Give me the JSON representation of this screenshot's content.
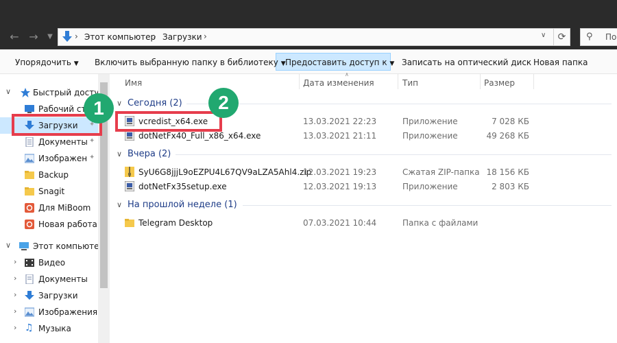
{
  "address": {
    "crumbs": [
      "Этот компьютер",
      "Загрузки"
    ],
    "search_placeholder": "По"
  },
  "commands": {
    "organize": "Упорядочить",
    "include_library": "Включить выбранную папку в библиотеку",
    "share": "Предоставить доступ к",
    "burn": "Записать на оптический диск",
    "new_folder": "Новая папка"
  },
  "sidebar": {
    "quick_access": "Быстрый доступ",
    "quick_items": [
      {
        "label": "Рабочий стол",
        "icon": "desktop-icon",
        "pinned": true
      },
      {
        "label": "Загрузки",
        "icon": "downloads-icon",
        "pinned": true,
        "selected": true
      },
      {
        "label": "Документы",
        "icon": "documents-icon",
        "pinned": true
      },
      {
        "label": "Изображения",
        "icon": "pictures-icon",
        "pinned": true
      },
      {
        "label": "Backup",
        "icon": "folder-icon",
        "pinned": false
      },
      {
        "label": "Snagit",
        "icon": "folder-icon",
        "pinned": false
      },
      {
        "label": "Для MiBoom",
        "icon": "app-folder-icon",
        "pinned": false
      },
      {
        "label": "Новая работа",
        "icon": "app-folder-icon",
        "pinned": false
      }
    ],
    "this_pc": "Этот компьютер",
    "pc_items": [
      {
        "label": "Видео",
        "icon": "video-icon"
      },
      {
        "label": "Документы",
        "icon": "documents-icon"
      },
      {
        "label": "Загрузки",
        "icon": "downloads-icon"
      },
      {
        "label": "Изображения",
        "icon": "pictures-icon"
      },
      {
        "label": "Музыка",
        "icon": "music-icon"
      }
    ]
  },
  "columns": {
    "name": "Имя",
    "date": "Дата изменения",
    "type": "Тип",
    "size": "Размер"
  },
  "groups": [
    {
      "title": "Сегодня (2)",
      "files": [
        {
          "name": "vcredist_x64.exe",
          "date": "13.03.2021 22:23",
          "type": "Приложение",
          "size": "7 028 КБ",
          "icon": "installer-icon"
        },
        {
          "name": "dotNetFx40_Full_x86_x64.exe",
          "date": "13.03.2021 21:11",
          "type": "Приложение",
          "size": "49 268 КБ",
          "icon": "installer-icon"
        }
      ]
    },
    {
      "title": "Вчера (2)",
      "files": [
        {
          "name": "SyU6G8jjjL9oEZPU4L67QV9aLZA5Ahl4.zip",
          "date": "12.03.2021 19:23",
          "type": "Сжатая ZIP-папка",
          "size": "18 156 КБ",
          "icon": "zip-icon"
        },
        {
          "name": "dotNetFx35setup.exe",
          "date": "12.03.2021 19:13",
          "type": "Приложение",
          "size": "2 803 КБ",
          "icon": "installer-icon"
        }
      ]
    },
    {
      "title": "На прошлой неделе (1)",
      "files": [
        {
          "name": "Telegram Desktop",
          "date": "07.03.2021 10:44",
          "type": "Папка с файлами",
          "size": "",
          "icon": "folder-icon"
        }
      ]
    }
  ],
  "annotations": {
    "step1": "1",
    "step2": "2",
    "highlight_color": "#e63d4c",
    "badge_color": "#21a870"
  }
}
